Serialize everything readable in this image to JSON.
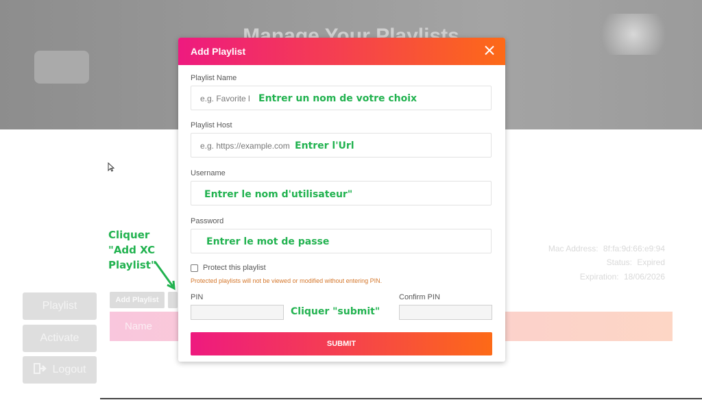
{
  "background": {
    "hero_title": "Manage Your Playlists",
    "sidebar": [
      {
        "label": "Playlist",
        "icon": ""
      },
      {
        "label": "Activate",
        "icon": ""
      },
      {
        "label": "Logout",
        "icon": "logout-icon"
      }
    ],
    "toolbar": {
      "add_playlist_label": "Add Playlist"
    },
    "table": {
      "name_header": "Name"
    },
    "device_info": {
      "mac_label": "Mac Address:",
      "mac_value": "8f:fa:9d:66:e9:94",
      "status_label": "Status:",
      "status_value": "Expired",
      "expiration_label": "Expiration:",
      "expiration_value": "18/06/2026"
    }
  },
  "modal": {
    "title": "Add Playlist",
    "playlist_name": {
      "label": "Playlist Name",
      "placeholder": "e.g. Favorite l"
    },
    "playlist_host": {
      "label": "Playlist Host",
      "placeholder": "e.g. https://example.com"
    },
    "username": {
      "label": "Username",
      "value": ""
    },
    "password": {
      "label": "Password",
      "value": ""
    },
    "protect": {
      "label": "Protect this playlist",
      "checked": false,
      "note": "Protected playlists will not be viewed or modified without entering PIN."
    },
    "pin": {
      "label": "PIN",
      "value": ""
    },
    "confirm_pin": {
      "label": "Confirm PIN",
      "value": ""
    },
    "submit_label": "SUBMIT"
  },
  "annotations": {
    "name_hint": "Entrer un nom de votre choix",
    "host_hint": "Entrer l'Url",
    "username_hint": "Entrer le nom d'utilisateur\"",
    "password_hint": "Entrer le mot de passe",
    "submit_hint": "Cliquer \"submit\"",
    "add_xc_hint_line1": "Cliquer",
    "add_xc_hint_line2": "\"Add XC",
    "add_xc_hint_line3": "Playlist\""
  },
  "colors": {
    "accent_start": "#ee1a7f",
    "accent_end": "#fd6a17",
    "annotation": "#21b24f"
  }
}
